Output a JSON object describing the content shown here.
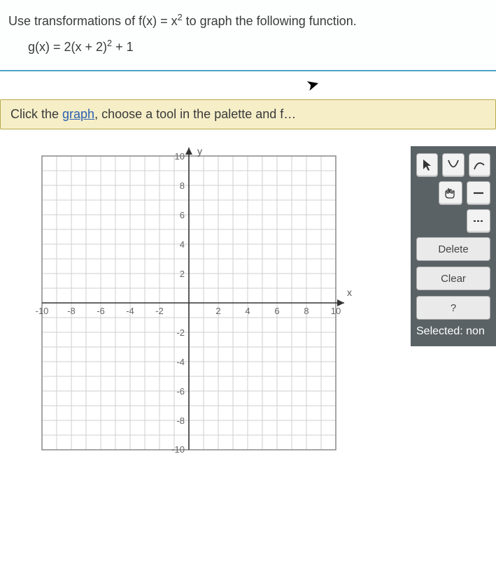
{
  "question": {
    "line1_pre": "Use transformations of f(x) = x",
    "line1_sup": "2",
    "line1_post": " to graph the following function.",
    "line2_pre": "g(x) = 2(x + 2)",
    "line2_sup": "2",
    "line2_post": " + 1"
  },
  "instruction": {
    "prefix": "Click the ",
    "link": "graph",
    "suffix": ", choose a tool in the palette and f…"
  },
  "chart_data": {
    "type": "scatter",
    "title": "",
    "xlabel": "x",
    "ylabel": "y",
    "xlim": [
      -10,
      10
    ],
    "ylim": [
      -10,
      10
    ],
    "x_ticks": [
      -10,
      -8,
      -6,
      -4,
      -2,
      2,
      4,
      6,
      8,
      10
    ],
    "y_ticks": [
      -10,
      -8,
      -6,
      -4,
      -2,
      2,
      4,
      6,
      8,
      10
    ],
    "grid": true,
    "series": []
  },
  "palette": {
    "delete": "Delete",
    "clear": "Clear",
    "help": "?",
    "selected_label": "Selected: ",
    "selected_value": "non",
    "tools": {
      "pointer": "pointer",
      "parabola": "parabola",
      "curve": "curve",
      "drag": "drag",
      "segment": "segment",
      "dashed": "dashed"
    }
  }
}
